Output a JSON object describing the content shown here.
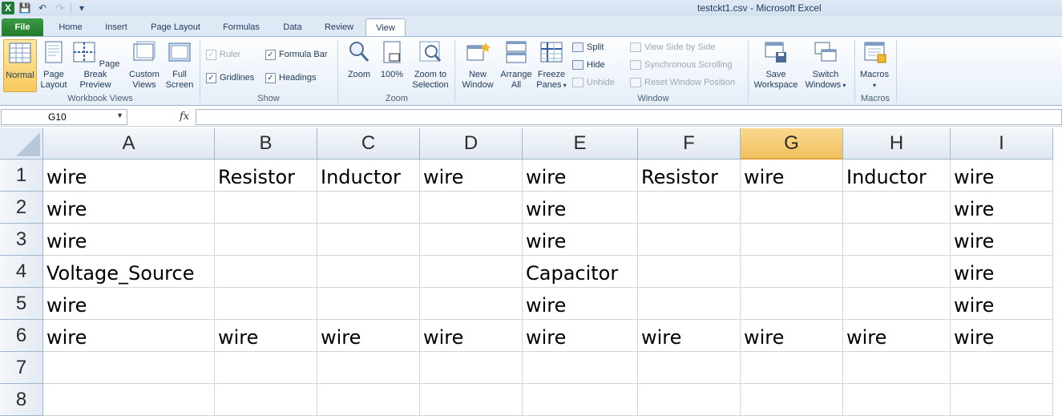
{
  "window": {
    "title": "testckt1.csv - Microsoft Excel"
  },
  "quick_access": {
    "app_icon": "X",
    "save_icon": "💾",
    "undo_icon": "↶",
    "redo_icon": "↷",
    "more_icon": "▾"
  },
  "tabs": [
    {
      "label": "File"
    },
    {
      "label": "Home"
    },
    {
      "label": "Insert"
    },
    {
      "label": "Page Layout"
    },
    {
      "label": "Formulas"
    },
    {
      "label": "Data"
    },
    {
      "label": "Review"
    },
    {
      "label": "View"
    }
  ],
  "ribbon": {
    "workbook_views": {
      "label": "Workbook Views",
      "buttons": [
        "Normal",
        "Page Layout",
        "Page Break Preview",
        "Custom Views",
        "Full Screen"
      ]
    },
    "show": {
      "label": "Show",
      "items": [
        {
          "label": "Ruler",
          "checked": true,
          "disabled": true
        },
        {
          "label": "Formula Bar",
          "checked": true
        },
        {
          "label": "Gridlines",
          "checked": true
        },
        {
          "label": "Headings",
          "checked": true
        }
      ]
    },
    "zoom": {
      "label": "Zoom",
      "buttons": [
        "Zoom",
        "100%",
        "Zoom to Selection"
      ]
    },
    "window": {
      "label": "Window",
      "buttons": [
        "New Window",
        "Arrange All",
        "Freeze Panes"
      ],
      "small": [
        "Split",
        "Hide",
        "Unhide"
      ],
      "side": [
        "View Side by Side",
        "Synchronous Scrolling",
        "Reset Window Position"
      ],
      "save_workspace": "Save Workspace",
      "switch_windows": "Switch Windows"
    },
    "macros": {
      "label": "Macros",
      "button": "Macros"
    }
  },
  "formula_bar": {
    "name_box": "G10",
    "fx": "fx",
    "value": ""
  },
  "grid": {
    "columns": [
      "A",
      "B",
      "C",
      "D",
      "E",
      "F",
      "G",
      "H",
      "I"
    ],
    "selected_column": "G",
    "rows": [
      {
        "n": "1",
        "cells": [
          "wire",
          "Resistor",
          "Inductor",
          "wire",
          "wire",
          "Resistor",
          "wire",
          "Inductor",
          "wire"
        ]
      },
      {
        "n": "2",
        "cells": [
          "wire",
          "",
          "",
          "",
          "wire",
          "",
          "",
          "",
          "wire"
        ]
      },
      {
        "n": "3",
        "cells": [
          "wire",
          "",
          "",
          "",
          "wire",
          "",
          "",
          "",
          "wire"
        ]
      },
      {
        "n": "4",
        "cells": [
          "Voltage_Source",
          "",
          "",
          "",
          "Capacitor",
          "",
          "",
          "",
          "wire"
        ]
      },
      {
        "n": "5",
        "cells": [
          "wire",
          "",
          "",
          "",
          "wire",
          "",
          "",
          "",
          "wire"
        ]
      },
      {
        "n": "6",
        "cells": [
          "wire",
          "wire",
          "wire",
          "wire",
          "wire",
          "wire",
          "wire",
          "wire",
          "wire"
        ]
      },
      {
        "n": "7",
        "cells": [
          "",
          "",
          "",
          "",
          "",
          "",
          "",
          "",
          ""
        ]
      },
      {
        "n": "8",
        "cells": [
          "",
          "",
          "",
          "",
          "",
          "",
          "",
          "",
          ""
        ]
      }
    ]
  }
}
